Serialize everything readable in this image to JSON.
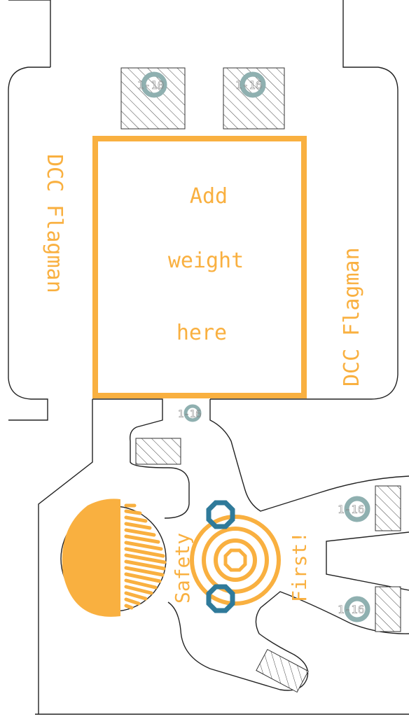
{
  "board": {
    "labels": {
      "add": "Add",
      "weight": "weight",
      "here": "here",
      "left_vertical": "DCC Flagman",
      "right_vertical": "DCC Flagman",
      "safety": "Safety",
      "first": "First!"
    },
    "pad_labels": [
      "1-10",
      "1-16",
      "1-16",
      "1-16",
      "1-16"
    ],
    "colors": {
      "silkscreen": "#f9b040",
      "outline": "#222222",
      "via_ring": "#8fb0b0",
      "via_blue": "#2f7a9a",
      "hatch": "#333333",
      "background": "#ffffff"
    }
  }
}
